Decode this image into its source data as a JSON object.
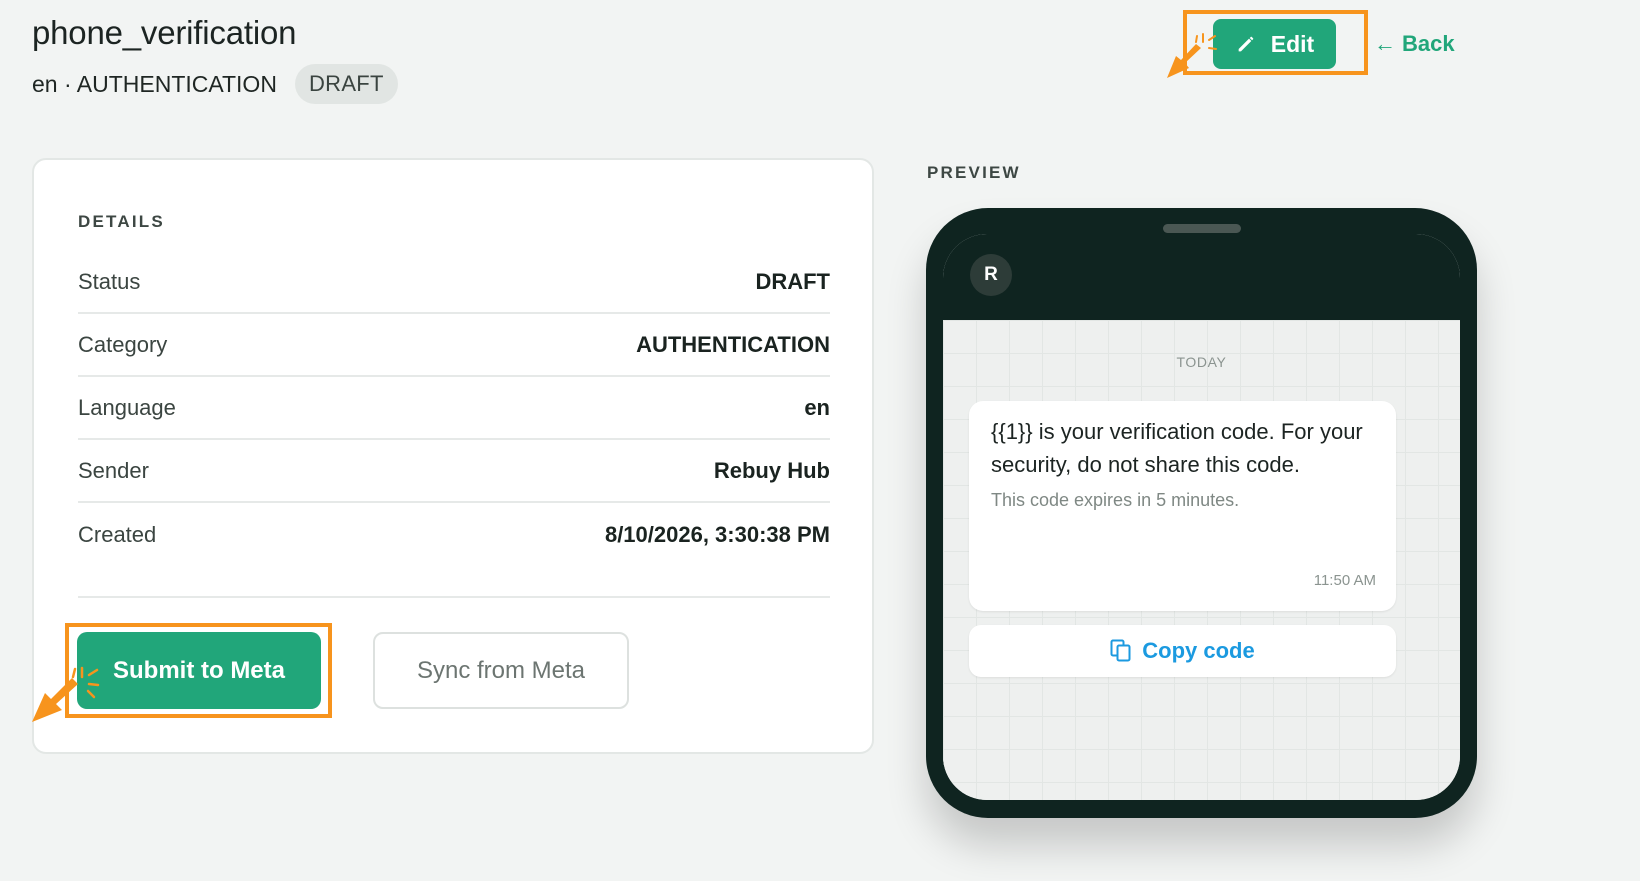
{
  "header": {
    "title": "phone_verification",
    "meta": "en · AUTHENTICATION",
    "badge": "DRAFT",
    "edit_label": "Edit",
    "back_arrow": "←",
    "back_label": "Back"
  },
  "details": {
    "section_label": "DETAILS",
    "rows": [
      {
        "label": "Status",
        "value": "DRAFT"
      },
      {
        "label": "Category",
        "value": "AUTHENTICATION"
      },
      {
        "label": "Language",
        "value": "en"
      },
      {
        "label": "Sender",
        "value": "Rebuy Hub"
      },
      {
        "label": "Created",
        "value": "8/10/2026, 3:30:38 PM"
      }
    ],
    "submit_label": "Submit to Meta",
    "sync_label": "Sync from Meta"
  },
  "preview": {
    "section_label": "PREVIEW",
    "avatar_initial": "R",
    "day_label": "TODAY",
    "message_body": "{{1}} is your verification code. For your security, do not share this code.",
    "message_footer": "This code expires in 5 minutes.",
    "message_time": "11:50 AM",
    "copy_label": "Copy code"
  },
  "colors": {
    "accent": "#21a67a",
    "highlight": "#f7941d",
    "link_blue": "#1b9ae0",
    "phone_frame": "#0f2420"
  },
  "icons": [
    "pencil-icon",
    "copy-icon",
    "cursor-click-icon"
  ]
}
